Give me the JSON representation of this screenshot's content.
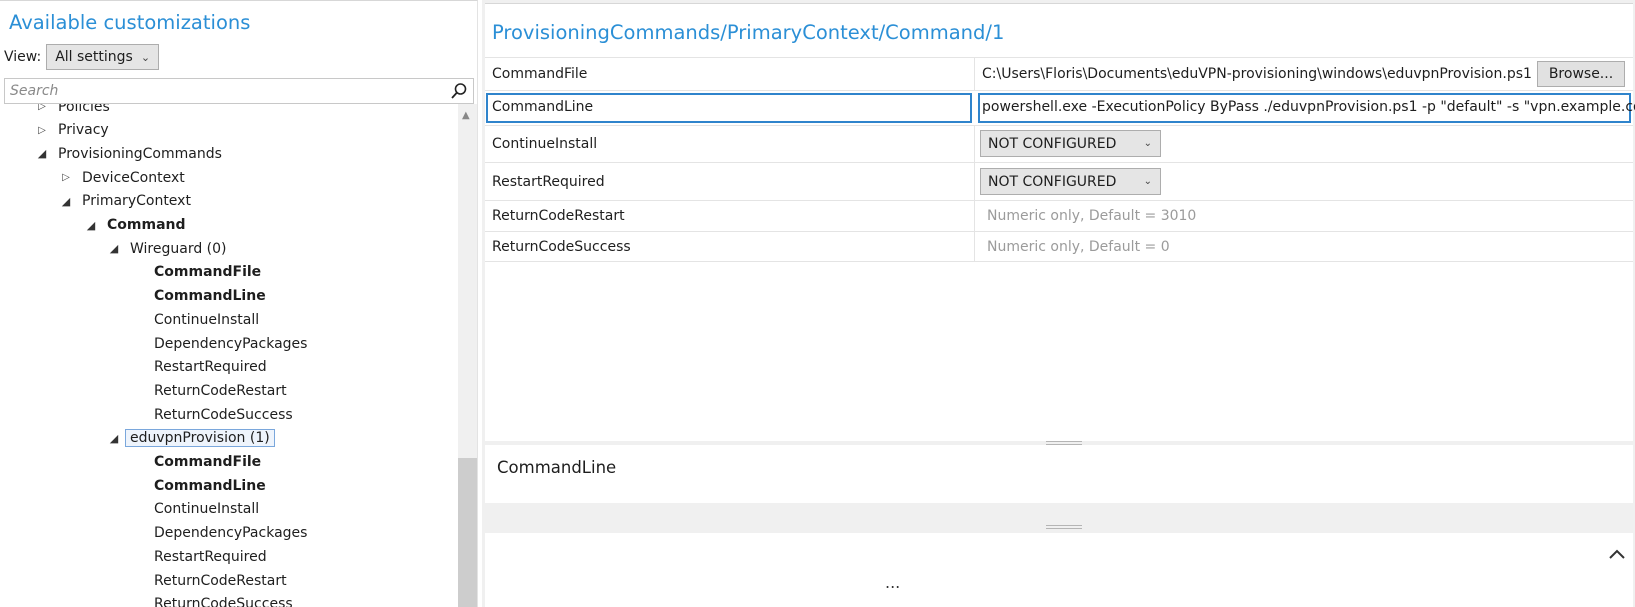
{
  "left": {
    "title": "Available customizations",
    "view_label": "View:",
    "view_value": "All settings",
    "search_placeholder": "Search",
    "tree": [
      {
        "label": "Policies",
        "depth": 1,
        "arrow": "closed",
        "bold": false,
        "clipped": true
      },
      {
        "label": "Privacy",
        "depth": 1,
        "arrow": "closed",
        "bold": false
      },
      {
        "label": "ProvisioningCommands",
        "depth": 1,
        "arrow": "open",
        "bold": false
      },
      {
        "label": "DeviceContext",
        "depth": 2,
        "arrow": "closed",
        "bold": false
      },
      {
        "label": "PrimaryContext",
        "depth": 2,
        "arrow": "open",
        "bold": false
      },
      {
        "label": "Command",
        "depth": 3,
        "arrow": "open",
        "bold": true
      },
      {
        "label": "Wireguard (0)",
        "depth": 4,
        "arrow": "open",
        "bold": false
      },
      {
        "label": "CommandFile",
        "depth": 5,
        "arrow": "none",
        "bold": true
      },
      {
        "label": "CommandLine",
        "depth": 5,
        "arrow": "none",
        "bold": true
      },
      {
        "label": "ContinueInstall",
        "depth": 5,
        "arrow": "none",
        "bold": false
      },
      {
        "label": "DependencyPackages",
        "depth": 5,
        "arrow": "none",
        "bold": false
      },
      {
        "label": "RestartRequired",
        "depth": 5,
        "arrow": "none",
        "bold": false
      },
      {
        "label": "ReturnCodeRestart",
        "depth": 5,
        "arrow": "none",
        "bold": false
      },
      {
        "label": "ReturnCodeSuccess",
        "depth": 5,
        "arrow": "none",
        "bold": false
      },
      {
        "label": "eduvpnProvision (1)",
        "depth": 4,
        "arrow": "open",
        "bold": false,
        "selected": true
      },
      {
        "label": "CommandFile",
        "depth": 5,
        "arrow": "none",
        "bold": true
      },
      {
        "label": "CommandLine",
        "depth": 5,
        "arrow": "none",
        "bold": true
      },
      {
        "label": "ContinueInstall",
        "depth": 5,
        "arrow": "none",
        "bold": false
      },
      {
        "label": "DependencyPackages",
        "depth": 5,
        "arrow": "none",
        "bold": false
      },
      {
        "label": "RestartRequired",
        "depth": 5,
        "arrow": "none",
        "bold": false
      },
      {
        "label": "ReturnCodeRestart",
        "depth": 5,
        "arrow": "none",
        "bold": false
      },
      {
        "label": "ReturnCodeSuccess",
        "depth": 5,
        "arrow": "none",
        "bold": false
      }
    ]
  },
  "right": {
    "path_title": "ProvisioningCommands/PrimaryContext/Command/1",
    "settings": [
      {
        "name": "CommandFile",
        "kind": "file",
        "value": "C:\\Users\\Floris\\Documents\\eduVPN-provisioning\\windows\\eduvpnProvision.ps1",
        "button": "Browse..."
      },
      {
        "name": "CommandLine",
        "kind": "text",
        "value": "powershell.exe -ExecutionPolicy ByPass ./eduvpnProvision.ps1 -p \"default\" -s \"vpn.example.com\"",
        "selected": true
      },
      {
        "name": "ContinueInstall",
        "kind": "dropdown",
        "value": "NOT CONFIGURED"
      },
      {
        "name": "RestartRequired",
        "kind": "dropdown",
        "value": "NOT CONFIGURED"
      },
      {
        "name": "ReturnCodeRestart",
        "kind": "hint",
        "value": "Numeric only, Default = 3010"
      },
      {
        "name": "ReturnCodeSuccess",
        "kind": "hint",
        "value": "Numeric only, Default = 0"
      }
    ],
    "description_title": "CommandLine",
    "bottom_ellipsis": "..."
  },
  "colors": {
    "accent_title": "#2b8fd6",
    "selection_border": "#2f84cc",
    "hint_text": "#9b9b9b"
  },
  "icons": {
    "search": "search-icon",
    "expanded": "triangle-down-icon",
    "collapsed": "triangle-right-icon",
    "dropdown": "chevron-down-icon",
    "collapse_panel": "chevron-up-icon"
  }
}
